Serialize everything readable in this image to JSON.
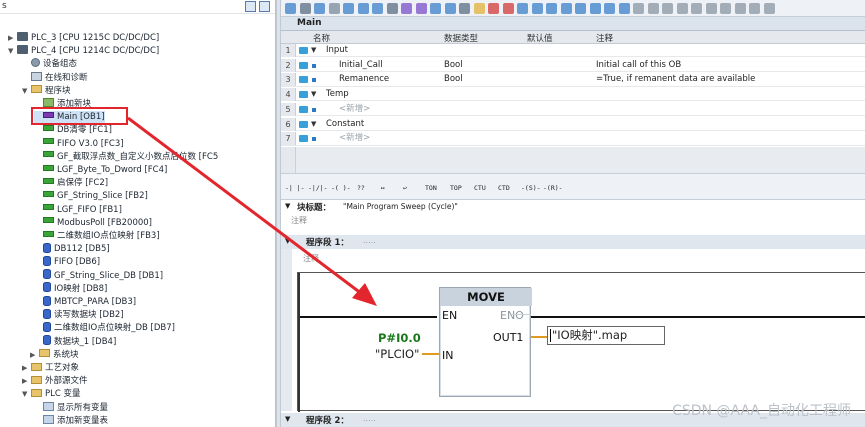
{
  "tree": {
    "header_label": "s",
    "items": [
      {
        "label": "PLC_3 [CPU 1215C DC/DC/DC]",
        "icon": "plc-icon",
        "arrow": "▶"
      },
      {
        "label": "PLC_4 [CPU 1214C DC/DC/DC]",
        "icon": "plc-icon",
        "arrow": "▼"
      },
      {
        "label": "设备组态",
        "icon": "device-config-icon",
        "arrow": ""
      },
      {
        "label": "在线和诊断",
        "icon": "online-diagnostics-icon",
        "arrow": ""
      },
      {
        "label": "程序块",
        "icon": "folder-icon",
        "arrow": "▼"
      },
      {
        "label": "添加新块",
        "icon": "add-block-icon",
        "arrow": ""
      },
      {
        "label": "Main [OB1]",
        "icon": "ob-icon",
        "arrow": ""
      },
      {
        "label": "DB清零 [FC1]",
        "icon": "fc-icon",
        "arrow": ""
      },
      {
        "label": "FIFO V3.0 [FC3]",
        "icon": "fc-icon",
        "arrow": ""
      },
      {
        "label": "GF_截取浮点数_自定义小数点后位数 [FC5",
        "icon": "fc-icon",
        "arrow": ""
      },
      {
        "label": "LGF_Byte_To_Dword [FC4]",
        "icon": "fc-icon",
        "arrow": ""
      },
      {
        "label": "启保停 [FC2]",
        "icon": "fc-icon",
        "arrow": ""
      },
      {
        "label": "GF_String_Slice [FB2]",
        "icon": "fb-icon",
        "arrow": ""
      },
      {
        "label": "LGF_FIFO [FB1]",
        "icon": "fb-icon",
        "arrow": ""
      },
      {
        "label": "ModbusPoll [FB20000]",
        "icon": "fb-icon",
        "arrow": ""
      },
      {
        "label": "二维数组IO点位映射 [FB3]",
        "icon": "fb-icon",
        "arrow": ""
      },
      {
        "label": "DB112 [DB5]",
        "icon": "db-icon",
        "arrow": ""
      },
      {
        "label": "FIFO [DB6]",
        "icon": "db-icon",
        "arrow": ""
      },
      {
        "label": "GF_String_Slice_DB [DB1]",
        "icon": "db-icon",
        "arrow": ""
      },
      {
        "label": "IO映射 [DB8]",
        "icon": "db-icon",
        "arrow": ""
      },
      {
        "label": "MBTCP_PARA [DB3]",
        "icon": "db-icon",
        "arrow": ""
      },
      {
        "label": "读写数据块 [DB2]",
        "icon": "db-icon",
        "arrow": ""
      },
      {
        "label": "二维数组IO点位映射_DB [DB7]",
        "icon": "db-icon",
        "arrow": ""
      },
      {
        "label": "数据块_1 [DB4]",
        "icon": "db-icon",
        "arrow": ""
      },
      {
        "label": "系统块",
        "icon": "folder-icon",
        "arrow": "▶"
      },
      {
        "label": "工艺对象",
        "icon": "folder-icon",
        "arrow": "▶"
      },
      {
        "label": "外部源文件",
        "icon": "folder-icon",
        "arrow": "▶"
      },
      {
        "label": "PLC 变量",
        "icon": "tag-folder-icon",
        "arrow": "▼"
      },
      {
        "label": "显示所有变量",
        "icon": "tag-table-icon",
        "arrow": ""
      },
      {
        "label": "添加新变量表",
        "icon": "tag-table-icon",
        "arrow": ""
      }
    ]
  },
  "editor": {
    "block_name": "Main",
    "interface": {
      "columns": [
        "名称",
        "数据类型",
        "默认值",
        "注释"
      ],
      "rows": [
        {
          "num": "1",
          "name": "Input",
          "type": "",
          "default": "",
          "comment": "",
          "level": 0,
          "expander": "▼"
        },
        {
          "num": "2",
          "name": "Initial_Call",
          "type": "Bool",
          "default": "",
          "comment": "Initial call of this OB",
          "level": 1,
          "expander": ""
        },
        {
          "num": "3",
          "name": "Remanence",
          "type": "Bool",
          "default": "",
          "comment": "=True, if remanent data are available",
          "level": 1,
          "expander": ""
        },
        {
          "num": "4",
          "name": "Temp",
          "type": "",
          "default": "",
          "comment": "",
          "level": 0,
          "expander": "▼"
        },
        {
          "num": "5",
          "name": "<新增>",
          "type": "",
          "default": "",
          "comment": "",
          "level": 1,
          "expander": ""
        },
        {
          "num": "6",
          "name": "Constant",
          "type": "",
          "default": "",
          "comment": "",
          "level": 0,
          "expander": "▼"
        },
        {
          "num": "7",
          "name": "<新增>",
          "type": "",
          "default": "",
          "comment": "",
          "level": 1,
          "expander": ""
        }
      ]
    },
    "lad_toolbar": [
      "-| |-",
      "-|/|-",
      "-( )-",
      "??",
      "↦",
      "↩",
      "TON",
      "TOP",
      "CTU",
      "CTD",
      "-(S)-",
      "-(R)-"
    ],
    "block_title_label": "块标题：",
    "block_title_value": "\"Main Program Sweep (Cycle)\"",
    "comment_label": "注释",
    "network1": {
      "label": "程序段 1：",
      "placeholder": ".....",
      "comment": "注释",
      "instruction": {
        "title": "MOVE",
        "pin_en": "EN",
        "pin_eno": "ENO",
        "pin_in": "IN",
        "pin_out1": "OUT1",
        "in_operand_addr": "P#I0.0",
        "in_operand": "\"PLCIO\"",
        "out1_operand": "\"IO映射\".map"
      }
    },
    "network2": {
      "label": "程序段 2：",
      "placeholder": "....."
    }
  },
  "watermark": "CSDN @AAA_自动化工程师",
  "colors": {
    "highlight_red": "#e3262d",
    "address_green": "#1a7a1a",
    "connection_orange": "#e09c22",
    "selection_blue": "#cfe1f5"
  }
}
